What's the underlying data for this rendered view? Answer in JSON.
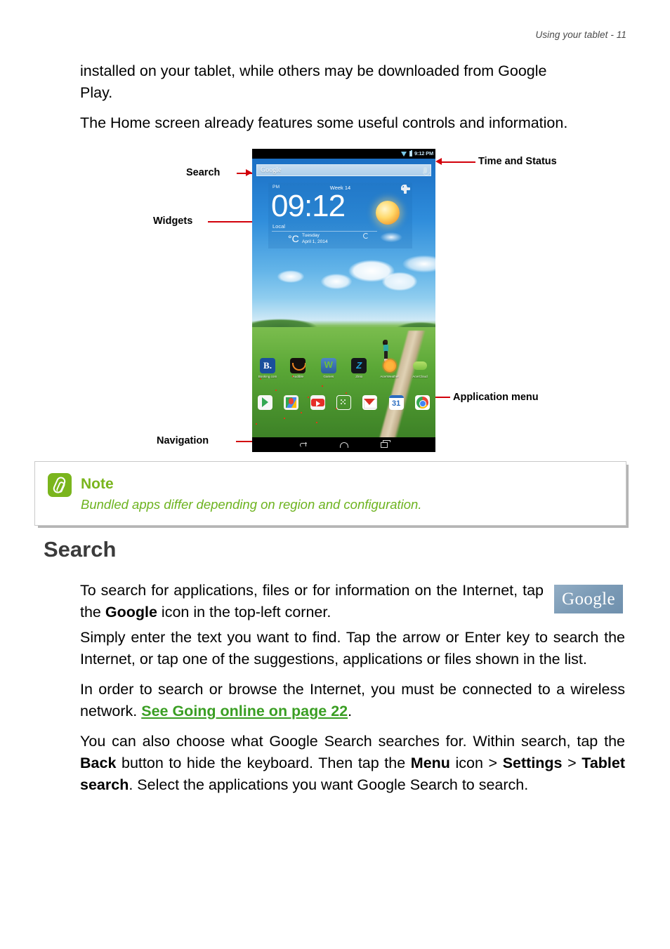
{
  "header": {
    "text": "Using your tablet - 11"
  },
  "paragraphs": {
    "p1_a": "installed on your tablet, while others may be downloaded from Google",
    "p1_b": "Play.",
    "p2": "The Home screen already features some useful controls and information.",
    "p3": "Simply enter the text you want to find. Tap the arrow or Enter key to search the Internet, or tap one of the suggestions, applications or files shown in the list.",
    "p4_pre": "In order to search or browse the Internet, you must be connected to a wireless network. ",
    "p4_link": "See Going online on page 22",
    "p4_post": ".",
    "p5_1": "You can also choose what Google Search searches for. Within search, tap the ",
    "p5_back": "Back",
    "p5_2": " button to hide the keyboard. Then tap the ",
    "p5_menu": "Menu",
    "p5_3": " icon > ",
    "p5_settings": "Settings",
    "p5_4": " > ",
    "p5_tablet": "Tablet search",
    "p5_5": ". Select the applications you want Google Search to search."
  },
  "search_para": {
    "pre": "To search for applications, files or for information on the Internet, tap the ",
    "bold": "Google",
    "post": "  icon in the top-left corner."
  },
  "figure": {
    "callouts": {
      "search": "Search",
      "widgets": "Widgets",
      "time_and_status": "Time and Status",
      "application_menu": "Application menu",
      "navigation": "Navigation"
    },
    "tablet": {
      "status_bar": {
        "time": "9:12 PM",
        "wifi_icon": "wifi-icon",
        "battery_icon": "battery-icon"
      },
      "search_bar": {
        "label": "Google",
        "mic_icon": "microphone-icon"
      },
      "clock_widget": {
        "meridiem": "PM",
        "week": "Week 14",
        "time": "09:12",
        "location": "Local",
        "unit": "°C",
        "day": "Tuesday",
        "date": "April 1, 2014",
        "settings_icon": "gear-icon",
        "refresh_icon": "refresh-icon",
        "weather_icon": "sun-icon"
      },
      "apps": [
        {
          "label": "Booking.com",
          "icon": "booking-icon",
          "glyph": "B."
        },
        {
          "label": "Audible",
          "icon": "audible-icon",
          "glyph": ""
        },
        {
          "label": "Games",
          "icon": "games-icon",
          "glyph": "W"
        },
        {
          "label": "Zinio",
          "icon": "zinio-icon",
          "glyph": "Z"
        },
        {
          "label": "AcerWeather",
          "icon": "acerweather-icon",
          "glyph": ""
        },
        {
          "label": "AcerCloud",
          "icon": "acercloud-icon",
          "glyph": ""
        }
      ],
      "dock": [
        {
          "icon": "play-store-icon"
        },
        {
          "icon": "maps-icon"
        },
        {
          "icon": "youtube-icon"
        },
        {
          "icon": "app-drawer-icon"
        },
        {
          "icon": "gmail-icon"
        },
        {
          "icon": "calendar-icon",
          "glyph": "31"
        },
        {
          "icon": "chrome-icon"
        }
      ],
      "navigation_bar": [
        {
          "icon": "back-icon"
        },
        {
          "icon": "home-icon"
        },
        {
          "icon": "recents-icon"
        }
      ]
    }
  },
  "note": {
    "icon": "note-pencil-icon",
    "title": "Note",
    "text": "Bundled apps differ depending on region and configuration."
  },
  "section": {
    "heading": "Search"
  },
  "google_logo": {
    "text": "Google"
  },
  "colors": {
    "accent_green": "#7ab51d",
    "link_green": "#3a9e23",
    "callout_red": "#d2000a",
    "heading_gray": "#3b3b3b",
    "google_box_blue": "#7d9cb7"
  }
}
